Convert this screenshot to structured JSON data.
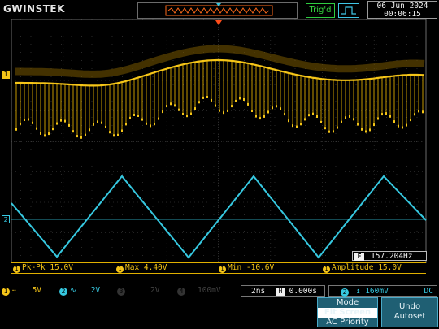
{
  "header": {
    "brand": "GWINSTEK",
    "trigger_status": "Trig'd",
    "date": "06 Jun 2024",
    "time": "00:06:15"
  },
  "channels": {
    "ch1_marker": "1",
    "ch2_marker": "2"
  },
  "frequency_readout": {
    "icon": "F",
    "value": "157.204Hz"
  },
  "measurements": [
    {
      "source": "1",
      "label": "Pk-Pk 15.0V"
    },
    {
      "source": "1",
      "label": "Max 4.40V"
    },
    {
      "source": "1",
      "label": "Min -10.6V"
    },
    {
      "source": "1",
      "label": "Amplitude 15.0V"
    }
  ],
  "status": {
    "ch1": {
      "num": "1",
      "coupling": "DC",
      "scale": "5V",
      "color": "#f5c518"
    },
    "ch2": {
      "num": "2",
      "coupling": "AC",
      "scale": "2V",
      "color": "#36c8e0"
    },
    "ch3": {
      "num": "3",
      "scale": "2V"
    },
    "ch4": {
      "num": "4",
      "scale": "100mV"
    },
    "timebase": "2ns",
    "h_icon": "H",
    "h_position": "0.000s",
    "trig_source": "2",
    "trig_level": "160mV",
    "trig_coupling": "DC"
  },
  "softkeys": {
    "mode_title": "Mode",
    "mode_option1": "Fit Screen",
    "mode_option2": "AC Priority",
    "undo_line1": "Undo",
    "undo_line2": "Autoset"
  },
  "colors": {
    "ch1": "#f5c518",
    "ch2": "#36c8e0",
    "grid": "#3a3a3a",
    "trigger_marker": "#ff4d1a"
  }
}
